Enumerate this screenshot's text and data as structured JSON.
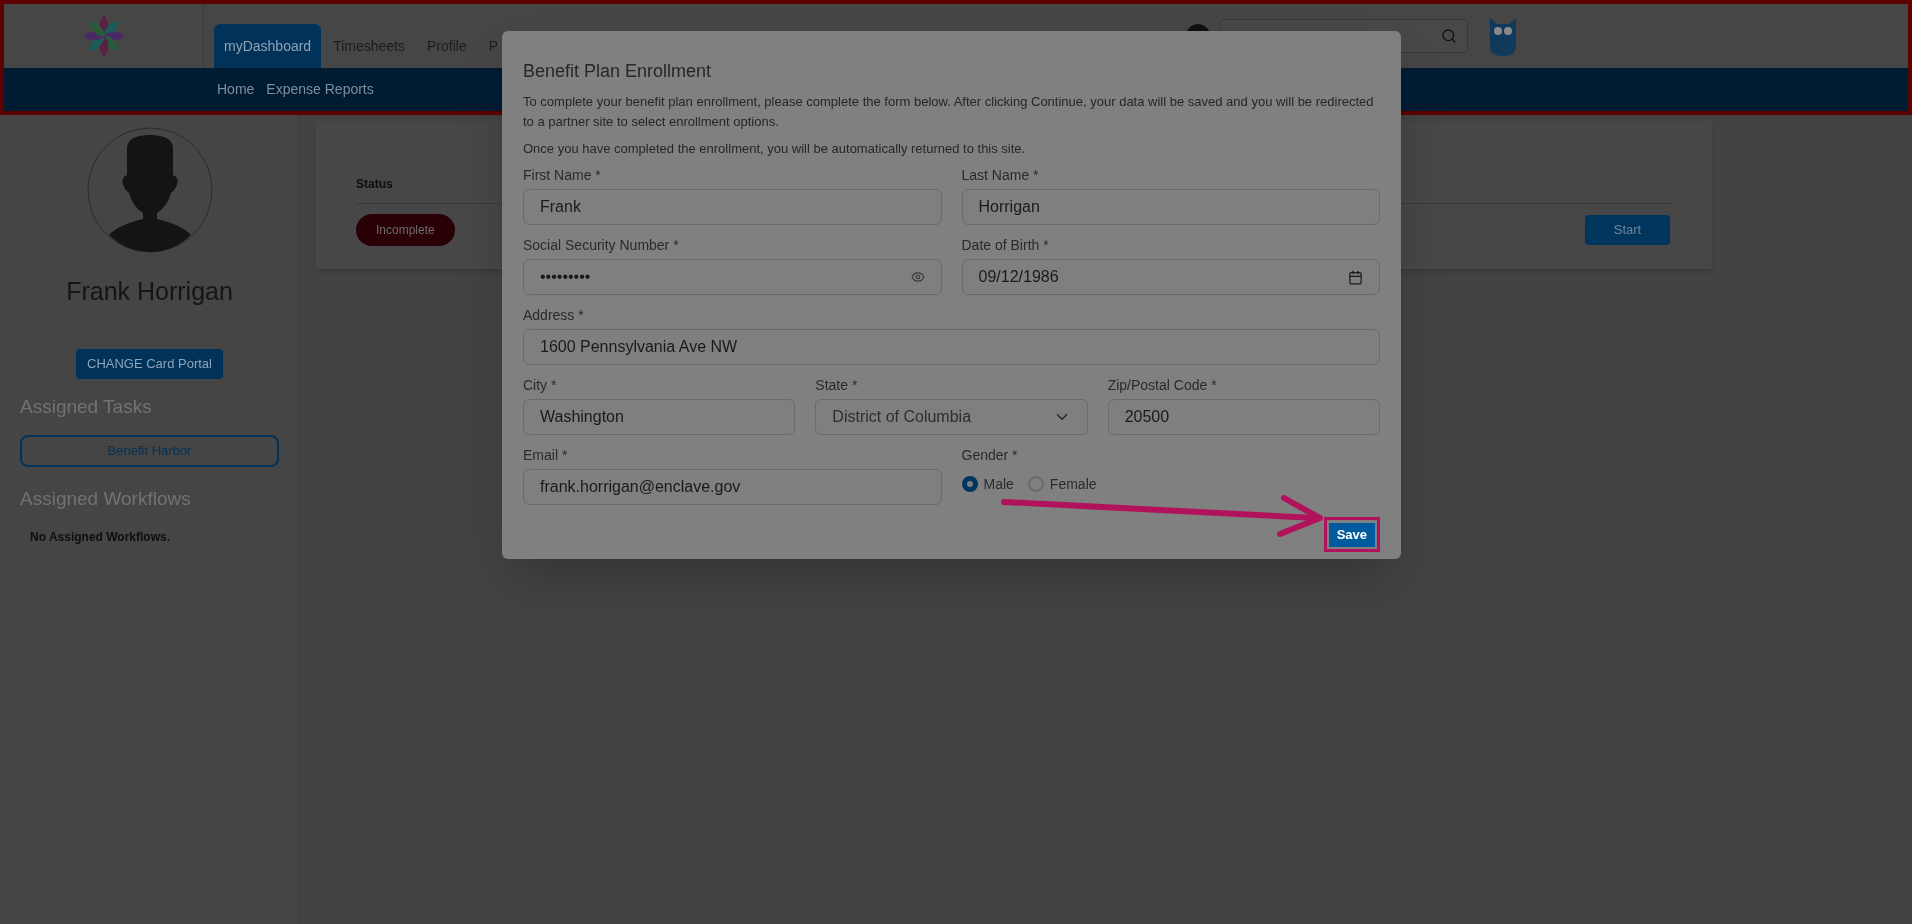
{
  "header": {
    "tabs": [
      {
        "label": "myDashboard",
        "selected": true
      },
      {
        "label": "Timesheets",
        "selected": false
      },
      {
        "label": "Profile",
        "selected": false
      },
      {
        "label": "P",
        "selected": false
      }
    ],
    "subnav": [
      "Home",
      "Expense Reports"
    ]
  },
  "sidebar": {
    "name": "Frank Horrigan",
    "portal_button": "CHANGE Card Portal",
    "tasks_heading": "Assigned Tasks",
    "tasks": [
      "Benefit Harbor"
    ],
    "workflows_heading": "Assigned Workflows",
    "workflows_empty": "No Assigned Workflows."
  },
  "card": {
    "column": "Status",
    "status": "Incomplete",
    "start_button": "Start"
  },
  "modal": {
    "title": "Benefit Plan Enrollment",
    "paragraphs": [
      "To complete your benefit plan enrollment, please complete the form below. After clicking Continue, your data will be saved and you will be redirected to a partner site to select enrollment options.",
      "Once you have completed the enrollment, you will be automatically returned to this site."
    ],
    "rows": [
      {
        "fields": [
          {
            "kind": "text",
            "label": "First Name *",
            "value": "Frank"
          },
          {
            "kind": "text",
            "label": "Last Name *",
            "value": "Horrigan"
          }
        ]
      },
      {
        "fields": [
          {
            "kind": "password",
            "label": "Social Security Number *",
            "value": "•••••••••"
          },
          {
            "kind": "date",
            "label": "Date of Birth *",
            "value": "09/12/1986"
          }
        ]
      },
      {
        "fields": [
          {
            "kind": "text",
            "label": "Address *",
            "value": "1600 Pennsylvania Ave NW"
          }
        ]
      },
      {
        "fields": [
          {
            "kind": "text",
            "label": "City *",
            "value": "Washington"
          },
          {
            "kind": "select",
            "label": "State *",
            "value": "District of Columbia"
          },
          {
            "kind": "text",
            "label": "Zip/Postal Code *",
            "value": "20500"
          }
        ]
      },
      {
        "fields": [
          {
            "kind": "text",
            "label": "Email *",
            "value": "frank.horrigan@enclave.gov"
          },
          {
            "kind": "radio",
            "label": "Gender *",
            "options": [
              {
                "label": "Male",
                "selected": true
              },
              {
                "label": "Female",
                "selected": false
              }
            ]
          }
        ]
      }
    ],
    "save_button": "Save"
  }
}
